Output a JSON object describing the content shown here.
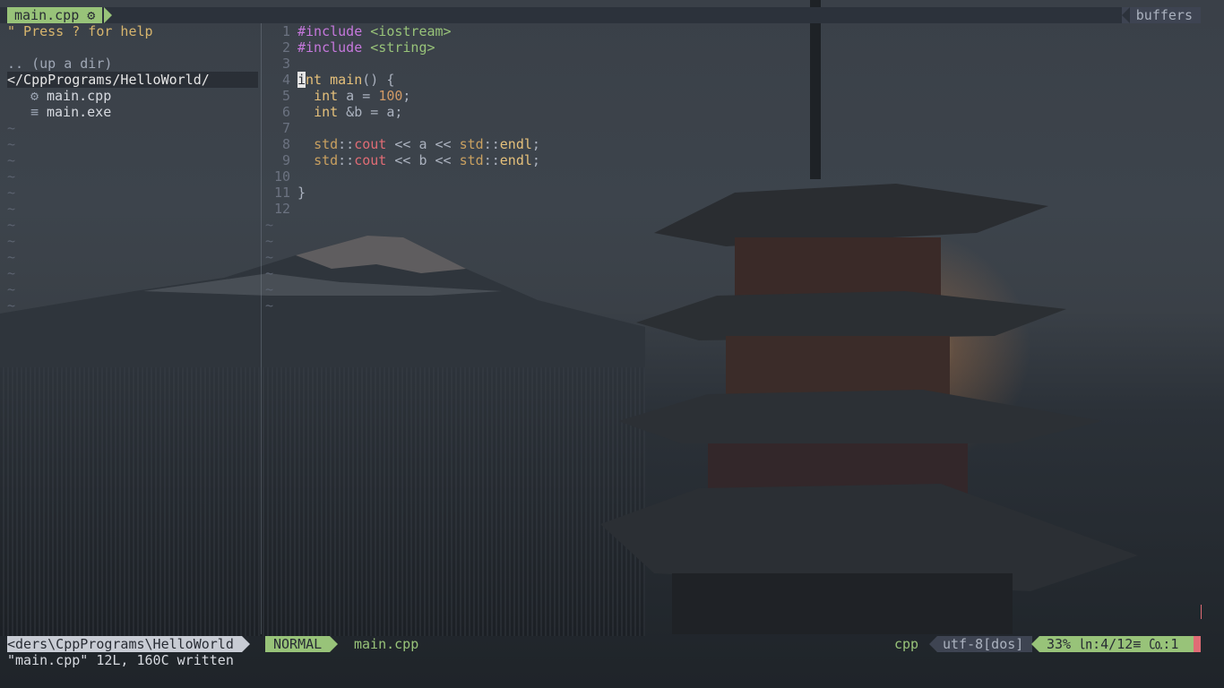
{
  "tabline": {
    "active_tab": "main.cpp",
    "active_tab_icon": "⚙",
    "right_label": "buffers"
  },
  "tree": {
    "help": "\" Press ? for help",
    "updir": ".. (up a dir)",
    "cwd": "</CppPrograms/HelloWorld/",
    "files": [
      {
        "icon": "⚙",
        "icon_name": "cpp-file-icon",
        "name": "main.cpp"
      },
      {
        "icon": "≡",
        "icon_name": "exe-file-icon",
        "name": "main.exe"
      }
    ],
    "tilde": "~"
  },
  "editor": {
    "lines": [
      {
        "n": "1"
      },
      {
        "n": "2"
      },
      {
        "n": "3"
      },
      {
        "n": "4"
      },
      {
        "n": "5"
      },
      {
        "n": "6"
      },
      {
        "n": "7"
      },
      {
        "n": "8"
      },
      {
        "n": "9"
      },
      {
        "n": "10"
      },
      {
        "n": "11"
      },
      {
        "n": "12"
      }
    ],
    "tokens": {
      "inc": "#include",
      "iostream": "<iostream>",
      "string": "<string>",
      "int": "int",
      "main": "main",
      "paren_brace": "() {",
      "a_decl": " a = ",
      "hundred": "100",
      "semi": ";",
      "ref_decl": " &b = a;",
      "std": "std",
      "colons": "::",
      "cout": "cout",
      "shift_a": " << a << ",
      "shift_b": " << b << ",
      "endl": "endl",
      "close_brace": "}"
    },
    "tilde": "~"
  },
  "statusline": {
    "cwd": "<ders\\CppPrograms\\HelloWorld",
    "mode": "NORMAL",
    "file": "main.cpp",
    "filetype": "cpp",
    "encoding": "utf-8[dos]",
    "position": "33% ㏑:4/12≡  ㏇:1"
  },
  "cmdline": "\"main.cpp\" 12L, 160C written",
  "colors": {
    "accent": "#98c379",
    "error": "#e06c75"
  }
}
